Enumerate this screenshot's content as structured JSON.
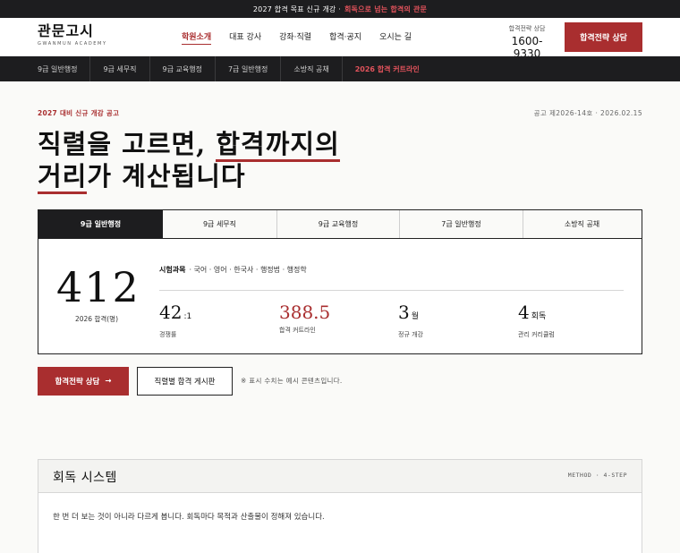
{
  "topbar": {
    "text_a": "2027 합격 목표 신규 개강 ·",
    "text_hl": "회독으로 넘는 합격의 관문"
  },
  "header": {
    "logo_ko": "관문고시",
    "logo_en": "GWANMUN ACADEMY",
    "nav": [
      "학원소개",
      "대표 강사",
      "강좌·직렬",
      "합격·공지",
      "오시는 길"
    ],
    "phone_label": "합격전략 상담",
    "phone_number": "1600-9330",
    "cta": "합격전략 상담"
  },
  "subnav": [
    "9급 일반행정",
    "9급 세무직",
    "9급 교육행정",
    "7급 일반행정",
    "소방직 공채",
    "2026 합격 커트라인"
  ],
  "hero": {
    "kicker": "2027 대비 신규 개강 공고",
    "notice": "공고 제2026-14호 · 2026.02.15",
    "headline_1a": "직렬을 고르면, ",
    "headline_1b": "합격까지의",
    "headline_2a": "거리",
    "headline_2b": "가 계산됩니다"
  },
  "panel": {
    "tabs": [
      "9급 일반행정",
      "9급 세무직",
      "9급 교육행정",
      "7급 일반행정",
      "소방직 공채"
    ],
    "big_number": "412",
    "big_caption": "2026 합격(명)",
    "subjects_label": "시험과목",
    "subjects": "· 국어 · 영어 · 한국사 · 행정법 · 행정학",
    "stats": [
      {
        "value": "42",
        "unit": ":1",
        "label": "경쟁률"
      },
      {
        "value": "388.5",
        "unit": "",
        "label": "합격 커트라인"
      },
      {
        "value": "3",
        "unit": "월",
        "label": "정규 개강"
      },
      {
        "value": "4",
        "unit": "회독",
        "label": "관리 커리큘럼"
      }
    ]
  },
  "actions": {
    "primary": "합격전략 상담",
    "primary_arrow": "→",
    "secondary": "직렬별 합격 게시판",
    "note": "※ 표시 수치는 예시 콘텐츠입니다."
  },
  "system": {
    "title": "회독 시스템",
    "meta": "METHOD · 4-STEP",
    "desc": "한 번 더 보는 것이 아니라 다르게 봅니다. 회독마다 목적과 산출물이 정해져 있습니다."
  },
  "colors": {
    "accent": "#a92e2f",
    "dark": "#1d1d1f",
    "highlight": "#e0525b"
  }
}
